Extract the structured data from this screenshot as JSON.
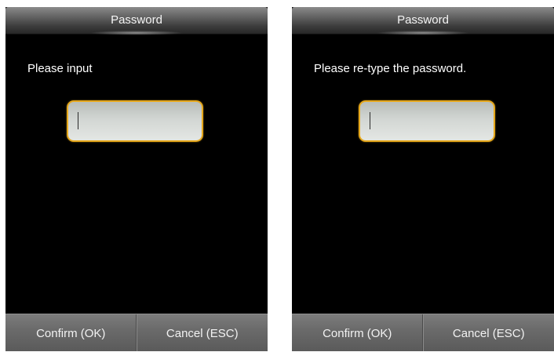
{
  "screens": [
    {
      "title": "Password",
      "prompt": "Please input",
      "field_value": "",
      "confirm_label": "Confirm (OK)",
      "cancel_label": "Cancel (ESC)"
    },
    {
      "title": "Password",
      "prompt": "Please re-type the password.",
      "field_value": "",
      "confirm_label": "Confirm (OK)",
      "cancel_label": "Cancel (ESC)"
    }
  ],
  "colors": {
    "screen_background": "#000000",
    "field_border": "#e6a81c",
    "title_bar": "#4a4a4a",
    "softkey_bar": "#6b6b6b",
    "text": "#ffffff"
  }
}
